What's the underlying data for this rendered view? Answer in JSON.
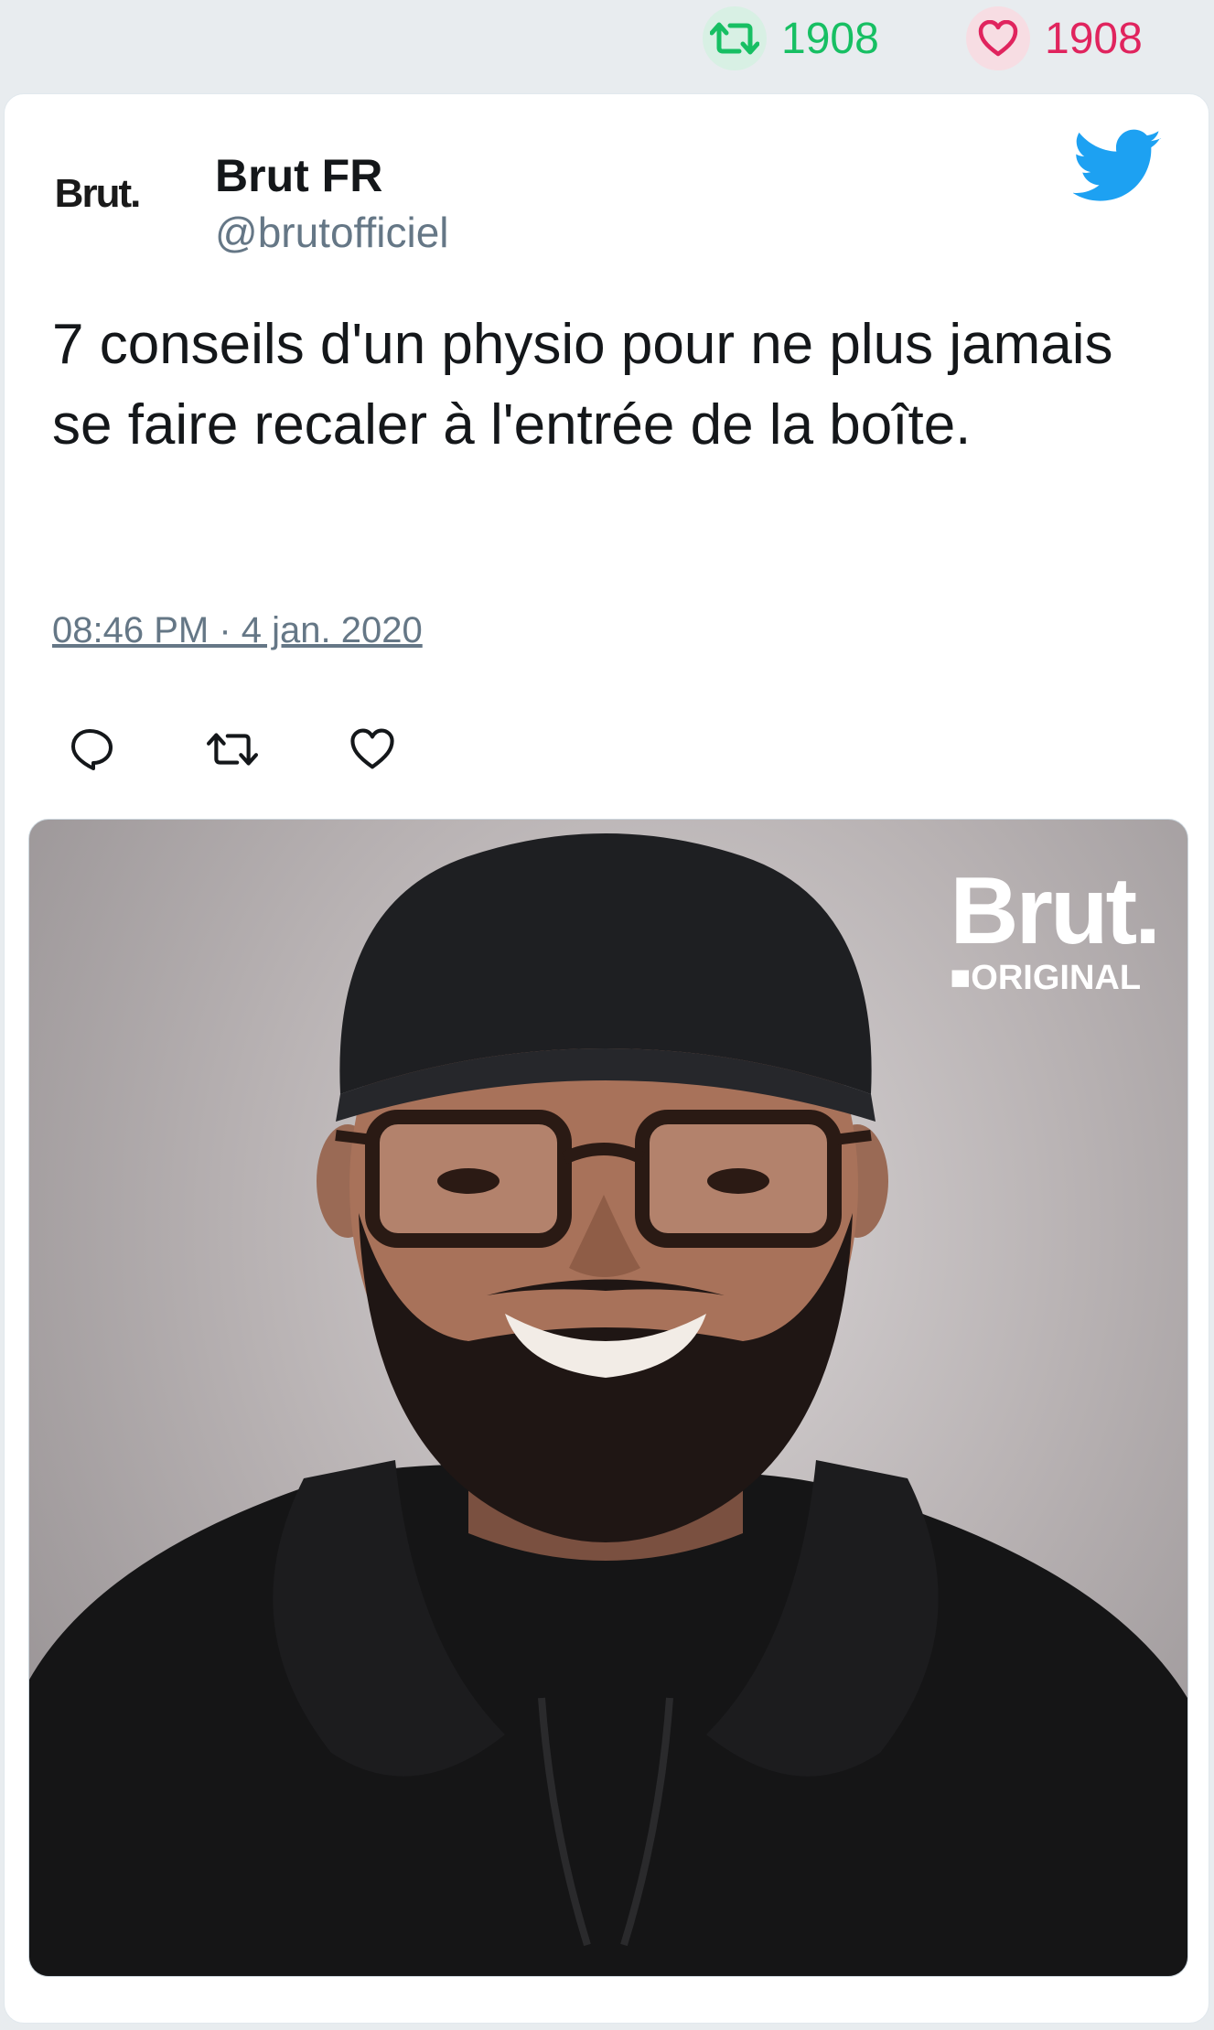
{
  "stats": {
    "retweet_count": "1908",
    "like_count": "1908"
  },
  "tweet": {
    "display_name": "Brut FR",
    "handle": "@brutofficiel",
    "avatar_text": "Brut.",
    "text": "7 conseils d'un physio pour ne plus jamais se faire recaler à l'entrée de la boîte.",
    "timestamp": "08:46 PM · 4 jan. 2020"
  },
  "media": {
    "watermark_main": "Brut.",
    "watermark_sub": "■ORIGINAL"
  },
  "icons": {
    "retweet": "retweet-icon",
    "like": "heart-icon",
    "reply": "reply-icon",
    "brand": "twitter-bird-icon"
  },
  "colors": {
    "retweet_green": "#17bf63",
    "like_red": "#e0245e",
    "twitter_blue": "#1da1f2",
    "muted_text": "#657786"
  }
}
